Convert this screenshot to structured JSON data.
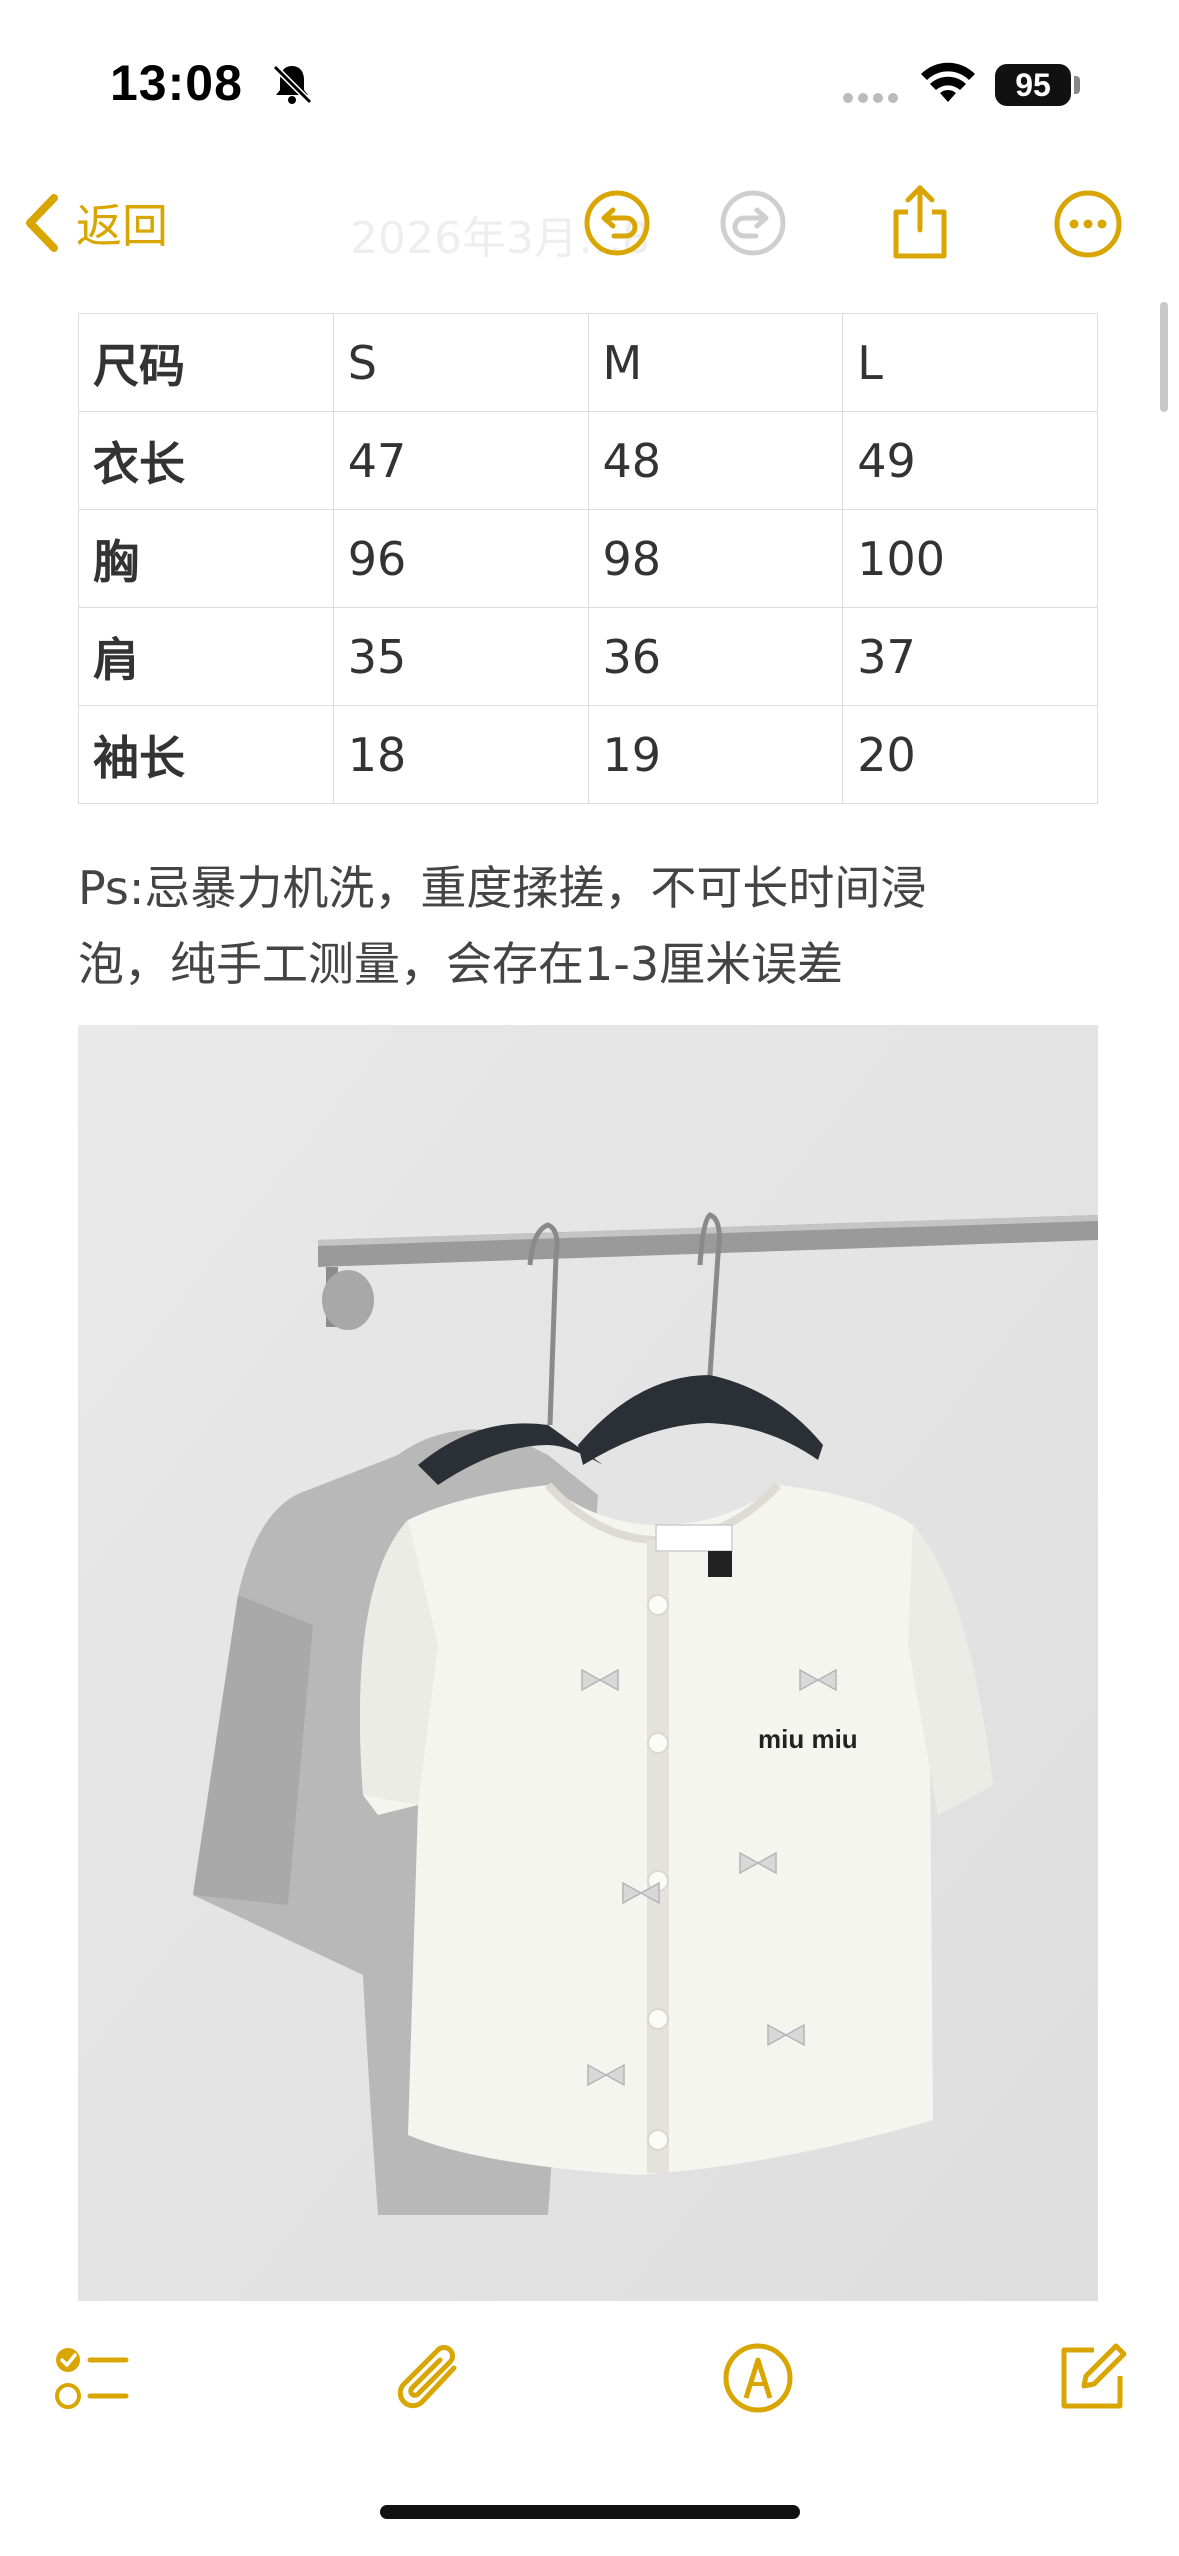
{
  "status_bar": {
    "time": "13:08",
    "battery": "95"
  },
  "nav": {
    "back_label": "返回",
    "title": "2026年3月…8"
  },
  "size_table": {
    "rows": [
      [
        "尺码",
        "S",
        "M",
        "L"
      ],
      [
        "衣长",
        "47",
        "48",
        "49"
      ],
      [
        "胸",
        "96",
        "98",
        "100"
      ],
      [
        "肩",
        "35",
        "36",
        "37"
      ],
      [
        "袖长",
        "18",
        "19",
        "20"
      ]
    ]
  },
  "note": {
    "line1": "Ps:忌暴力机洗，重度揉搓，不可长时间浸",
    "line2": "泡，纯手工测量，会存在1-3厘米误差"
  },
  "photo": {
    "label_text": "miu miu"
  },
  "colors": {
    "accent": "#D9A500"
  },
  "icons": [
    "bell-slash-icon",
    "wifi-icon",
    "battery-icon",
    "chevron-left-icon",
    "undo-icon",
    "redo-icon",
    "share-icon",
    "more-icon",
    "checklist-icon",
    "paperclip-icon",
    "markup-icon",
    "compose-icon"
  ]
}
